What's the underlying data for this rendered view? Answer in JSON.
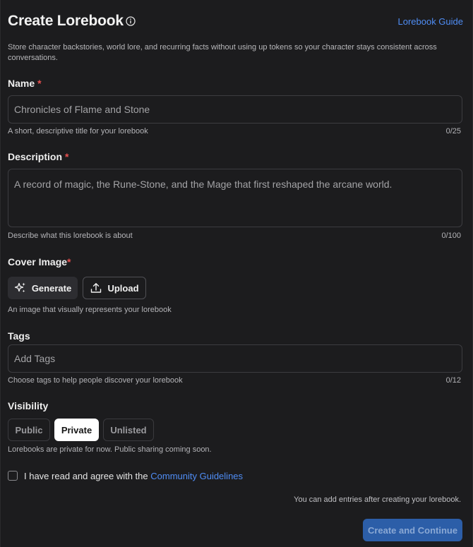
{
  "header": {
    "title": "Create Lorebook",
    "guide_link": "Lorebook Guide",
    "subtitle": "Store character backstories, world lore, and recurring facts without using up tokens so your character stays consistent across conversations."
  },
  "name_field": {
    "label": "Name",
    "required_mark": "*",
    "placeholder": "Chronicles of Flame and Stone",
    "value": "",
    "hint": "A short, descriptive title for your lorebook",
    "counter": "0/25"
  },
  "description_field": {
    "label": "Description",
    "required_mark": "*",
    "placeholder": "A record of magic, the Rune-Stone, and the Mage that first reshaped the arcane world.",
    "value": "",
    "hint": "Describe what this lorebook is about",
    "counter": "0/100"
  },
  "cover_image": {
    "label": "Cover Image",
    "required_mark": "*",
    "generate_label": "Generate",
    "upload_label": "Upload",
    "hint": "An image that visually represents your lorebook"
  },
  "tags_field": {
    "label": "Tags",
    "placeholder": "Add Tags",
    "hint": "Choose tags to help people discover your lorebook",
    "counter": "0/12"
  },
  "visibility": {
    "label": "Visibility",
    "options": [
      "Public",
      "Private",
      "Unlisted"
    ],
    "selected": "Private",
    "note": "Lorebooks are private for now. Public sharing coming soon."
  },
  "agreement": {
    "text": "I have read and agree with the",
    "link": "Community Guidelines",
    "checked": false
  },
  "footer": {
    "note": "You can add entries after creating your lorebook.",
    "submit_label": "Create and Continue"
  },
  "colors": {
    "background": "#1c1c1e",
    "accent": "#4f8df5",
    "required": "#e8504f",
    "submit_bg": "#2c5ea8"
  }
}
